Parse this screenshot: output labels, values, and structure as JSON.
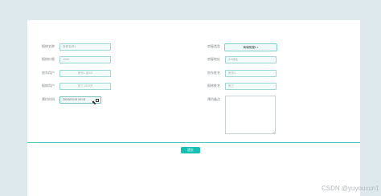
{
  "form": {
    "left": [
      {
        "label": "报修名称",
        "placeholder": "报修名称1"
      },
      {
        "label": "报修价格",
        "placeholder": "1000"
      },
      {
        "label": "房东用户",
        "placeholder": "房东1-张XX"
      },
      {
        "label": "报修用户",
        "placeholder": "张三-23.0万"
      },
      {
        "label": "预约时间",
        "value": "2024/01/15 10:13"
      }
    ],
    "right": [
      {
        "label": "房屋类型",
        "value": "商铺房屋1"
      },
      {
        "label": "房屋地址",
        "placeholder": "XX地址"
      },
      {
        "label": "房东姓名",
        "placeholder": "房东1"
      },
      {
        "label": "报修姓名",
        "placeholder": "张三"
      },
      {
        "label": "预约备注",
        "placeholder": ""
      }
    ],
    "select_caret": "▾"
  },
  "actions": {
    "submit_label": "提交"
  },
  "watermark": "CSDN @yuyouxun1",
  "colors": {
    "accent": "#17c0b3",
    "divider": "#4ec6c0",
    "background": "#dde9ec"
  }
}
